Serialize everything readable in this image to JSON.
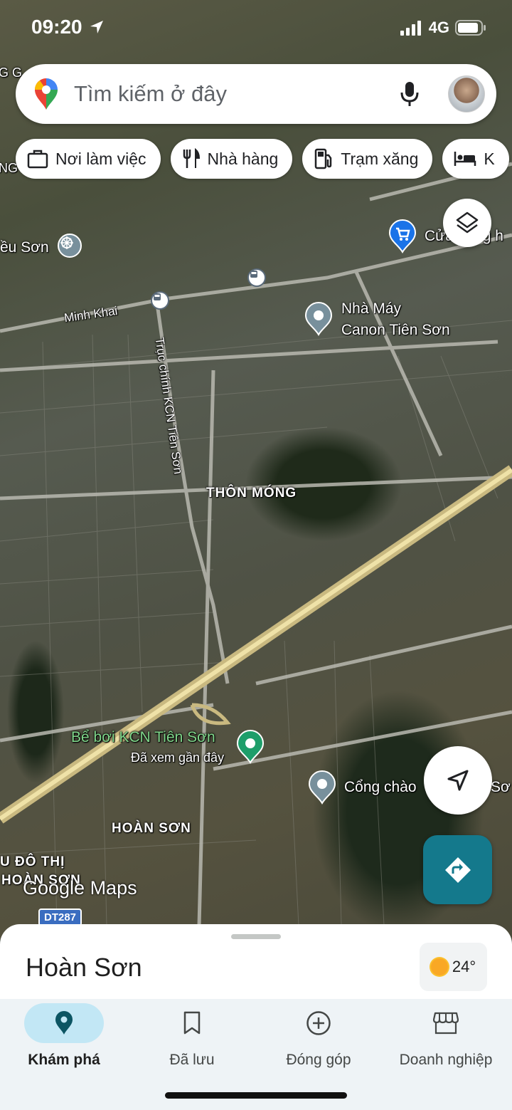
{
  "status_bar": {
    "time": "09:20",
    "network": "4G",
    "icons": [
      "location-arrow-icon",
      "signal-icon",
      "battery-icon"
    ]
  },
  "search": {
    "placeholder": "Tìm kiếm ở đây",
    "icons": [
      "google-maps-pin-icon",
      "microphone-icon",
      "avatar"
    ]
  },
  "chips": [
    {
      "label": "Nơi làm việc",
      "icon": "briefcase-icon"
    },
    {
      "label": "Nhà hàng",
      "icon": "restaurant-icon"
    },
    {
      "label": "Trạm xăng",
      "icon": "gas-station-icon"
    },
    {
      "label": "K",
      "icon": "hotel-icon"
    }
  ],
  "map": {
    "labels": {
      "dieu_son": "ều Sơn",
      "cua_hang": "Cửa hàng h",
      "minh_khai": "Minh Khai",
      "nha_may_1": "Nhà Máy",
      "nha_may_2": "Canon Tiên Sơn",
      "truc_chinh": "Trục chính KCN Tiên Sơn",
      "thon_mong": "THÔN MÓNG",
      "be_boi": "Bể bơi KCN Tiên Sơn",
      "da_xem": "Đã xem gần đây",
      "cong_chao": "Cổng chào",
      "cong_chao_end": "Sơ",
      "hoan_son": "HOÀN SƠN",
      "khu_do_thi_1": "U ĐÔ THỊ",
      "khu_do_thi_2": "HOÀN SƠN",
      "top_left_1": "G G",
      "top_left_2": "NG",
      "road_shield": "DT287"
    },
    "logo": "Google Maps"
  },
  "sheet": {
    "title": "Hoàn Sơn",
    "temperature": "24°",
    "weather_icon": "sun-icon"
  },
  "nav": [
    {
      "label": "Khám phá",
      "icon": "explore-pin-icon",
      "active": true
    },
    {
      "label": "Đã lưu",
      "icon": "bookmark-icon",
      "active": false
    },
    {
      "label": "Đóng góp",
      "icon": "add-circle-icon",
      "active": false
    },
    {
      "label": "Doanh nghiệp",
      "icon": "storefront-icon",
      "active": false
    }
  ],
  "colors": {
    "accent": "#14798c",
    "nav_active_bg": "#c2e7f5",
    "green_poi": "#1e9e6a",
    "gray_poi": "#78909c",
    "shop_poi": "#1a73e8"
  }
}
